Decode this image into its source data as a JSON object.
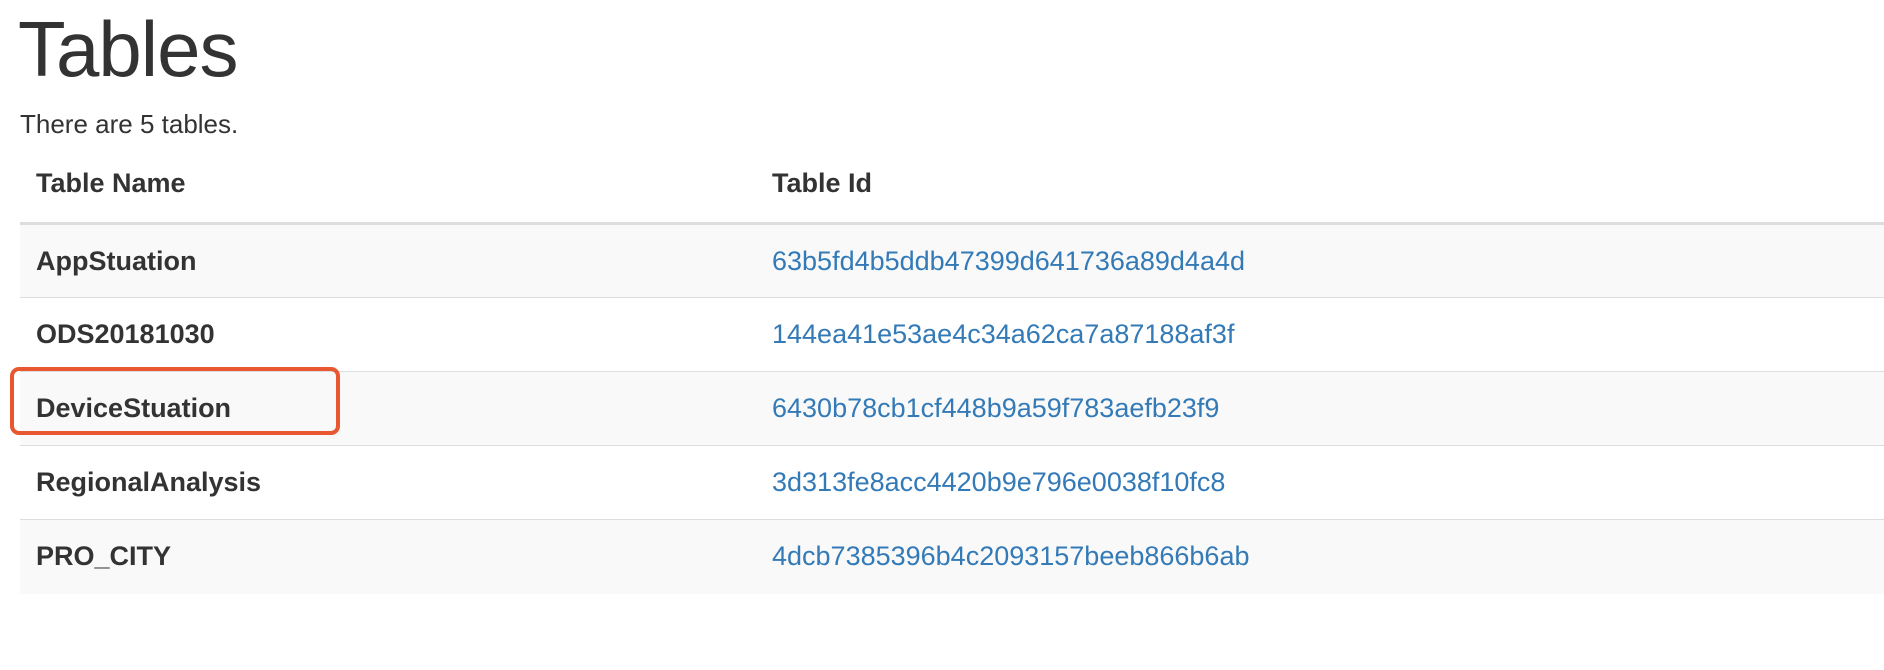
{
  "page": {
    "title": "Tables",
    "summary": "There are 5 tables."
  },
  "table": {
    "headers": [
      "Table Name",
      "Table Id"
    ],
    "rows": [
      {
        "name": "AppStuation",
        "id": "63b5fd4b5ddb47399d641736a89d4a4d"
      },
      {
        "name": "ODS20181030",
        "id": "144ea41e53ae4c34a62ca7a87188af3f"
      },
      {
        "name": "DeviceStuation",
        "id": "6430b78cb1cf448b9a59f783aefb23f9"
      },
      {
        "name": "RegionalAnalysis",
        "id": "3d313fe8acc4420b9e796e0038f10fc8"
      },
      {
        "name": "PRO_CITY",
        "id": "4dcb7385396b4c2093157beeb866b6ab"
      }
    ]
  },
  "annotation": {
    "highlighted_row": "DeviceStuation",
    "color": "#e8572f"
  },
  "colors": {
    "link": "#337ab7",
    "text": "#333333",
    "stripe": "#f9f9f9",
    "border": "#dddddd"
  }
}
